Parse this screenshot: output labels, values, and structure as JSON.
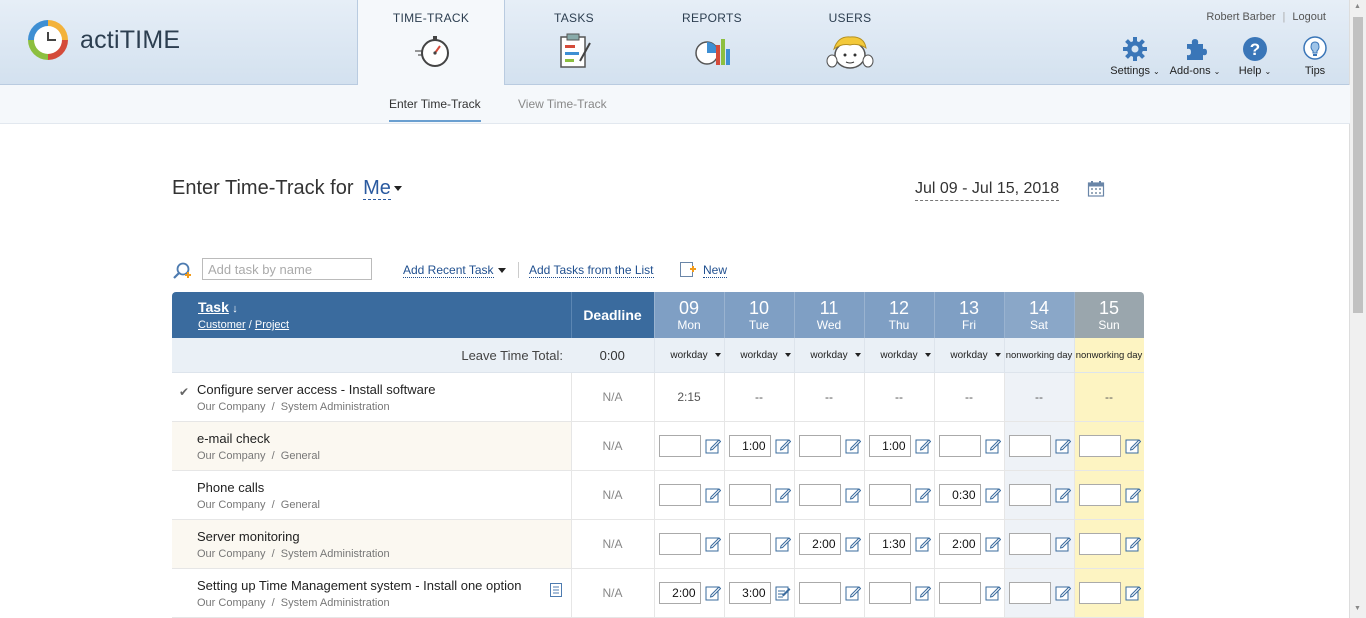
{
  "app": {
    "name": "actiTIME"
  },
  "nav": [
    {
      "label": "TIME-TRACK",
      "icon": "stopwatch-icon",
      "active": true
    },
    {
      "label": "TASKS",
      "icon": "task-list-icon"
    },
    {
      "label": "REPORTS",
      "icon": "chart-icon"
    },
    {
      "label": "USERS",
      "icon": "user-avatar-icon"
    }
  ],
  "topright": {
    "user": "Robert Barber",
    "logout": "Logout"
  },
  "tools": [
    {
      "label": "Settings",
      "icon": "gear-icon",
      "dropdown": true
    },
    {
      "label": "Add-ons",
      "icon": "puzzle-icon",
      "dropdown": true
    },
    {
      "label": "Help",
      "icon": "help-icon",
      "dropdown": true
    },
    {
      "label": "Tips",
      "icon": "lightbulb-icon"
    }
  ],
  "subnav": {
    "enter": "Enter Time-Track",
    "view": "View Time-Track"
  },
  "page": {
    "title_prefix": "Enter Time-Track for",
    "user": "Me",
    "date_range": "Jul 09 - Jul 15, 2018"
  },
  "toolbar": {
    "search_placeholder": "Add task by name",
    "add_recent": "Add Recent Task",
    "add_from_list": "Add Tasks from the List",
    "new": "New"
  },
  "table": {
    "header": {
      "task": "Task",
      "customer": "Customer",
      "project": "Project",
      "deadline": "Deadline"
    },
    "days": [
      {
        "num": "09",
        "name": "Mon",
        "type": "workday"
      },
      {
        "num": "10",
        "name": "Tue",
        "type": "workday"
      },
      {
        "num": "11",
        "name": "Wed",
        "type": "workday"
      },
      {
        "num": "12",
        "name": "Thu",
        "type": "workday"
      },
      {
        "num": "13",
        "name": "Fri",
        "type": "workday"
      },
      {
        "num": "14",
        "name": "Sat",
        "type": "nonworking day"
      },
      {
        "num": "15",
        "name": "Sun",
        "type": "nonworking day"
      }
    ],
    "leave_label": "Leave Time Total:",
    "leave_total": "0:00",
    "rows": [
      {
        "name": "Configure server access - Install software",
        "customer": "Our Company",
        "project": "System Administration",
        "deadline": "N/A",
        "completed": true,
        "readonly": true,
        "values": [
          "2:15",
          "--",
          "--",
          "--",
          "--",
          "--",
          "--"
        ]
      },
      {
        "name": "e-mail check",
        "customer": "Our Company",
        "project": "General",
        "deadline": "N/A",
        "values": [
          "",
          "1:00",
          "",
          "1:00",
          "",
          "",
          ""
        ]
      },
      {
        "name": "Phone calls",
        "customer": "Our Company",
        "project": "General",
        "deadline": "N/A",
        "values": [
          "",
          "",
          "",
          "",
          "0:30",
          "",
          ""
        ]
      },
      {
        "name": "Server monitoring",
        "customer": "Our Company",
        "project": "System Administration",
        "deadline": "N/A",
        "values": [
          "",
          "",
          "2:00",
          "1:30",
          "2:00",
          "",
          ""
        ]
      },
      {
        "name": "Setting up Time Management system - Install one option",
        "customer": "Our Company",
        "project": "System Administration",
        "deadline": "N/A",
        "has_note": true,
        "values": [
          "2:00",
          "3:00",
          "",
          "",
          "",
          "",
          ""
        ]
      }
    ]
  }
}
